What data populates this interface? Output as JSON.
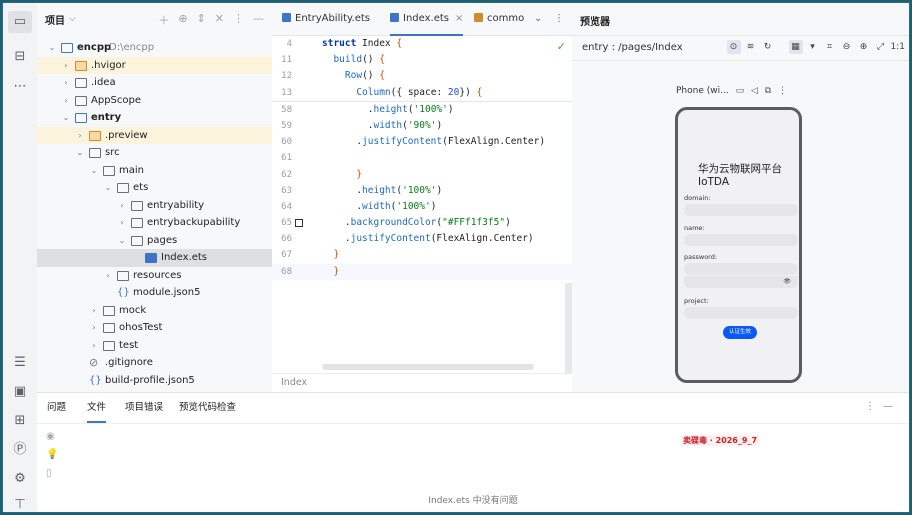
{
  "project_panel": {
    "title": "项目",
    "tree": [
      {
        "label": "encpp",
        "path": "D:\\encpp",
        "bold": true
      },
      {
        "label": ".hvigor"
      },
      {
        "label": ".idea"
      },
      {
        "label": "AppScope"
      },
      {
        "label": "entry",
        "bold": true
      },
      {
        "label": ".preview"
      },
      {
        "label": "src"
      },
      {
        "label": "main"
      },
      {
        "label": "ets"
      },
      {
        "label": "entryability"
      },
      {
        "label": "entrybackupability"
      },
      {
        "label": "pages"
      },
      {
        "label": "Index.ets"
      },
      {
        "label": "resources"
      },
      {
        "label": "module.json5"
      },
      {
        "label": "mock"
      },
      {
        "label": "ohosTest"
      },
      {
        "label": "test"
      },
      {
        "label": ".gitignore"
      },
      {
        "label": "build-profile.json5"
      }
    ]
  },
  "editor": {
    "tabs": [
      {
        "label": "EntryAbility.ets"
      },
      {
        "label": "Index.ets"
      },
      {
        "label": "commo"
      }
    ],
    "lines": [
      {
        "n": "4",
        "parts": [
          [
            "kw",
            "struct "
          ],
          [
            "pl",
            "Index "
          ],
          [
            "br",
            "{"
          ]
        ]
      },
      {
        "n": "11",
        "parts": [
          [
            "pl",
            "  "
          ],
          [
            "fn",
            "build"
          ],
          [
            "pl",
            "() "
          ],
          [
            "br",
            "{"
          ]
        ]
      },
      {
        "n": "12",
        "parts": [
          [
            "pl",
            "    "
          ],
          [
            "fn",
            "Row"
          ],
          [
            "pl",
            "() "
          ],
          [
            "br",
            "{"
          ]
        ]
      },
      {
        "n": "13",
        "parts": [
          [
            "pl",
            "      "
          ],
          [
            "fn",
            "Column"
          ],
          [
            "pl",
            "({ "
          ],
          [
            "pl",
            "space"
          ],
          [
            "pl",
            ": "
          ],
          [
            "num",
            "20"
          ],
          [
            "pl",
            "}) "
          ],
          [
            "br",
            "{"
          ]
        ]
      },
      {
        "n": "58",
        "parts": [
          [
            "pl",
            "        ."
          ],
          [
            "fn",
            "height"
          ],
          [
            "pl",
            "("
          ],
          [
            "st",
            "'100%'"
          ],
          [
            "pl",
            ")"
          ]
        ]
      },
      {
        "n": "59",
        "parts": [
          [
            "pl",
            "        ."
          ],
          [
            "fn",
            "width"
          ],
          [
            "pl",
            "("
          ],
          [
            "st",
            "'90%'"
          ],
          [
            "pl",
            ")"
          ]
        ]
      },
      {
        "n": "60",
        "parts": [
          [
            "pl",
            "      ."
          ],
          [
            "fn",
            "justifyContent"
          ],
          [
            "pl",
            "(FlexAlign.Center)"
          ]
        ]
      },
      {
        "n": "61",
        "parts": [
          [
            "pl",
            ""
          ]
        ]
      },
      {
        "n": "62",
        "parts": [
          [
            "pl",
            "      "
          ],
          [
            "br",
            "}"
          ]
        ]
      },
      {
        "n": "63",
        "parts": [
          [
            "pl",
            "      ."
          ],
          [
            "fn",
            "height"
          ],
          [
            "pl",
            "("
          ],
          [
            "st",
            "'100%'"
          ],
          [
            "pl",
            ")"
          ]
        ]
      },
      {
        "n": "64",
        "parts": [
          [
            "pl",
            "      ."
          ],
          [
            "fn",
            "width"
          ],
          [
            "pl",
            "("
          ],
          [
            "st",
            "'100%'"
          ],
          [
            "pl",
            ")"
          ]
        ]
      },
      {
        "n": "65",
        "parts": [
          [
            "pl",
            "    ."
          ],
          [
            "fn",
            "backgroundColor"
          ],
          [
            "pl",
            "("
          ],
          [
            "st",
            "\"#FFf1f3f5\""
          ],
          [
            "pl",
            ")"
          ]
        ]
      },
      {
        "n": "66",
        "parts": [
          [
            "pl",
            "    ."
          ],
          [
            "fn",
            "justifyContent"
          ],
          [
            "pl",
            "(FlexAlign.Center)"
          ]
        ]
      },
      {
        "n": "67",
        "parts": [
          [
            "pl",
            "  "
          ],
          [
            "br",
            "}"
          ]
        ]
      },
      {
        "n": "68",
        "parts": [
          [
            "pl",
            "  "
          ],
          [
            "br",
            "}"
          ]
        ]
      }
    ],
    "breadcrumb": "Index"
  },
  "previewer": {
    "title": "预览器",
    "route": "entry : /pages/Index",
    "zoom": "1:1",
    "device": "Phone (wi...",
    "app": {
      "title": "华为云物联网平台IoTDA",
      "fields": [
        "domain:",
        "name:",
        "password:",
        "project:"
      ],
      "button": "认证生效"
    }
  },
  "bottom_panel": {
    "tabs": [
      "问题",
      "文件",
      "项目错误",
      "预览代码检查"
    ],
    "active_tab": "文件",
    "message": "Index.ets 中没有问题",
    "watermark": "卖碟毒 · 2026_9_7"
  },
  "colors": {
    "accent": "#3d74c8",
    "keyword": "#0033b3",
    "string": "#067d17",
    "device_button": "#0a59f7"
  }
}
